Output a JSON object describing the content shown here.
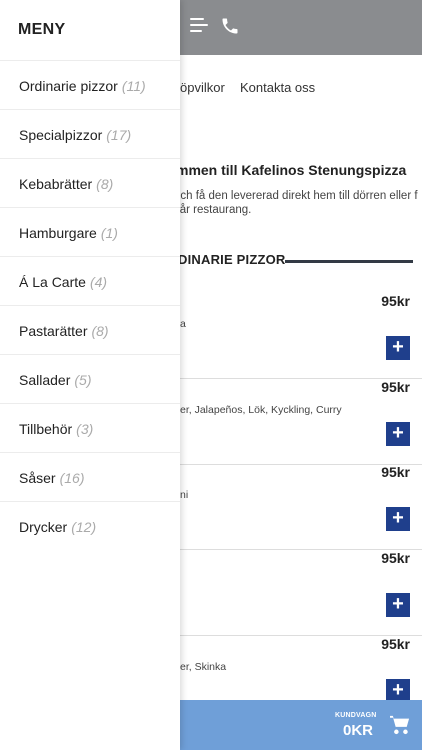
{
  "drawer": {
    "title": "MENY",
    "items": [
      {
        "label": "Ordinarie pizzor",
        "count": "(11)"
      },
      {
        "label": "Specialpizzor",
        "count": "(17)"
      },
      {
        "label": "Kebabrätter",
        "count": "(8)"
      },
      {
        "label": "Hamburgare",
        "count": "(1)"
      },
      {
        "label": "Á La Carte",
        "count": "(4)"
      },
      {
        "label": "Pastarätter",
        "count": "(8)"
      },
      {
        "label": "Sallader",
        "count": "(5)"
      },
      {
        "label": "Tillbehör",
        "count": "(3)"
      },
      {
        "label": "Såser",
        "count": "(16)"
      },
      {
        "label": "Drycker",
        "count": "(12)"
      }
    ]
  },
  "header": {
    "menu_icon": "hamburger-menu-icon",
    "phone_icon": "phone-icon"
  },
  "nav": {
    "links": [
      "öpvilkor",
      "Kontakta oss"
    ]
  },
  "intro": {
    "title": "mmen till Kafelinos Stenungspizza",
    "subtitle": "och få den levererad direkt hem till dörren eller f vår restaurang."
  },
  "section": {
    "heading": "DINARIE PIZZOR"
  },
  "products": [
    {
      "price": "95kr",
      "ingredients": "a",
      "add": "+"
    },
    {
      "price": "95kr",
      "ingredients": "er, Jalapeños, Lök, Kyckling, Curry",
      "add": "+"
    },
    {
      "price": "95kr",
      "ingredients": "ni",
      "add": "+"
    },
    {
      "price": "95kr",
      "ingredients": "",
      "add": "+"
    },
    {
      "price": "95kr",
      "ingredients": "er, Skinka",
      "add": "+"
    }
  ],
  "cart": {
    "label": "KUNDVAGN",
    "total": "0KR",
    "icon": "shopping-cart-icon"
  },
  "colors": {
    "header_bg": "#8a8c8f",
    "cart_bg": "#6f9fd8",
    "add_button": "#1f3f8c",
    "section_rule": "#333a45"
  }
}
